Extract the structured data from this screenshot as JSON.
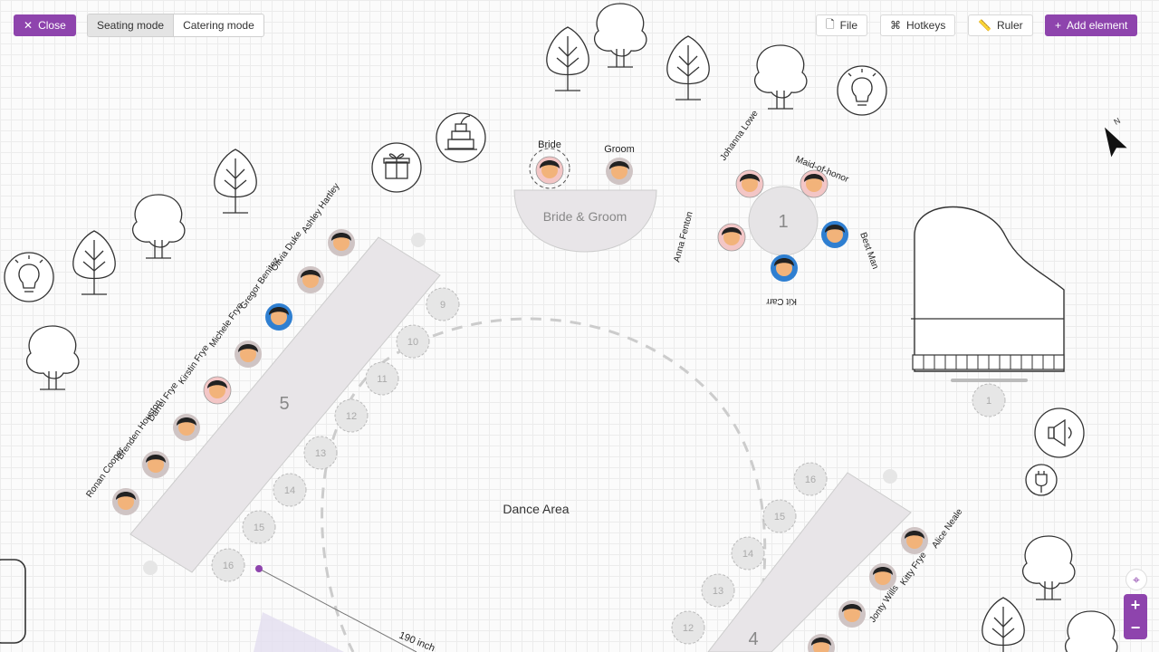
{
  "toolbar": {
    "close_label": "Close",
    "seating_mode_label": "Seating mode",
    "catering_mode_label": "Catering mode",
    "file_label": "File",
    "hotkeys_label": "Hotkeys",
    "ruler_label": "Ruler",
    "add_element_label": "Add element"
  },
  "colors": {
    "accent": "#8e44ad",
    "male_seat": "#2f7fd1",
    "female_seat": "#f3c6c6"
  },
  "floor": {
    "dance_area_label": "Dance Area",
    "bride_groom_table_label": "Bride & Groom",
    "bride_label": "Bride",
    "groom_label": "Groom",
    "table1_number": "1",
    "table4_number": "4",
    "table5_number": "5",
    "piano_seat_number": "1",
    "ruler_measurement": "190 inch"
  },
  "table1_guests": [
    "Johanna Lowe",
    "Maid-of-honor",
    "Best Man",
    "Kit Carr",
    "Anna Fenton"
  ],
  "table5_guests": [
    "Ashley Hartley",
    "Olivia Duke",
    "Gregor Benitez",
    "Michele Frye",
    "Kirstin Frye",
    "Darrel Frye",
    "Brenden Houston",
    "Ronan Cooper"
  ],
  "table5_empty_seats": [
    "9",
    "10",
    "11",
    "12",
    "13",
    "14",
    "15",
    "16"
  ],
  "table4_guests": [
    "Alice Neale",
    "Kitty Frye",
    "Jonty Wills"
  ],
  "table4_empty_seats": [
    "16",
    "15",
    "14",
    "13",
    "12"
  ],
  "icons": [
    "close-icon",
    "file-icon",
    "hotkeys-icon",
    "ruler-icon",
    "plus-icon",
    "gift-icon",
    "cake-icon",
    "lightbulb-icon",
    "speaker-icon",
    "power-outlet-icon",
    "compass-icon",
    "tree-icon",
    "piano-icon",
    "locate-icon",
    "zoom-in-icon",
    "zoom-out-icon"
  ]
}
